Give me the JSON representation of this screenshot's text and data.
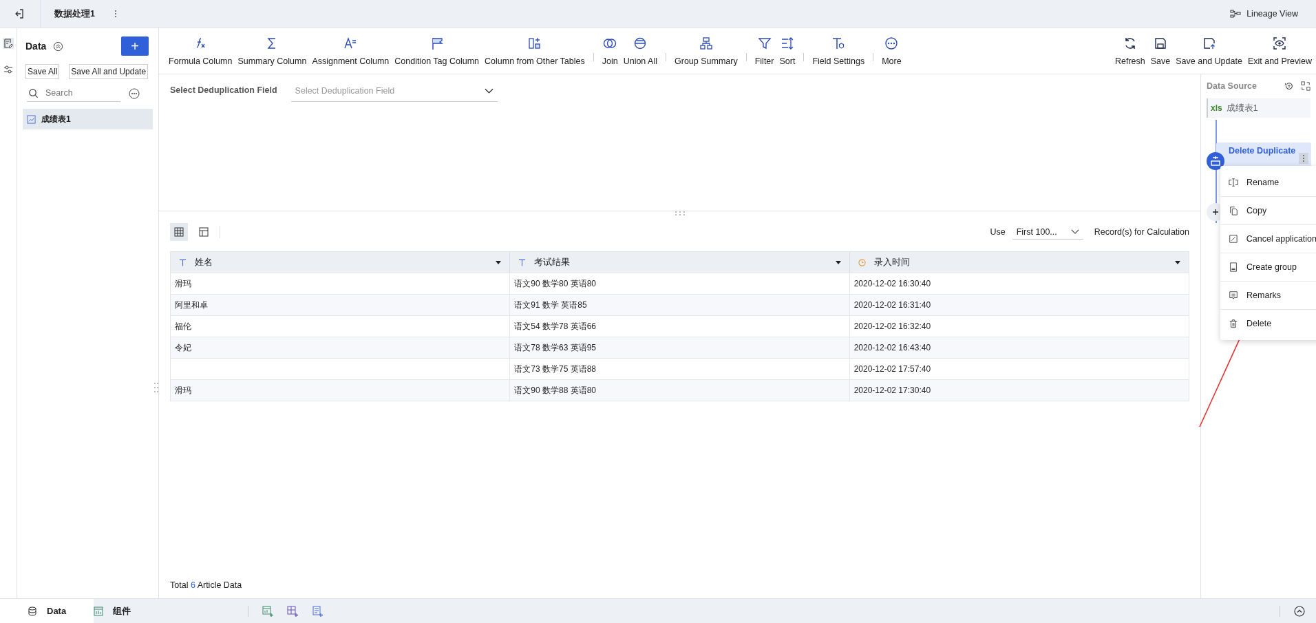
{
  "top_bar": {
    "title": "数据处理1",
    "lineage": "Lineage View"
  },
  "sidebar": {
    "title": "Data",
    "add": "+",
    "buttons": [
      "Save All",
      "Save All and Update"
    ],
    "search": {
      "placeholder": "Search"
    },
    "items": [
      {
        "label": "成绩表1",
        "selected": true
      }
    ]
  },
  "toolbar": {
    "groups": [
      [
        {
          "label": "Formula Column"
        },
        {
          "label": "Summary Column"
        },
        {
          "label": "Assignment Column"
        },
        {
          "label": "Condition Tag Column"
        },
        {
          "label": "Column from Other Tables"
        }
      ],
      [
        {
          "label": "Join"
        },
        {
          "label": "Union All"
        }
      ],
      [
        {
          "label": "Group Summary"
        }
      ],
      [
        {
          "label": "Filter"
        },
        {
          "label": "Sort"
        }
      ],
      [
        {
          "label": "Field Settings"
        }
      ],
      [
        {
          "label": "More"
        }
      ]
    ],
    "actions": [
      {
        "label": "Refresh"
      },
      {
        "label": "Save"
      },
      {
        "label": "Save and Update"
      },
      {
        "label": "Exit and Preview"
      }
    ]
  },
  "dedup": {
    "label": "Select Deduplication Field",
    "placeholder": "Select Deduplication Field"
  },
  "table_toolbar": {
    "views": [
      {
        "selected": true
      },
      {
        "selected": false
      }
    ],
    "use": "Use",
    "limit": "First 100...",
    "suffix": "Record(s) for Calculation"
  },
  "table": {
    "columns": [
      {
        "label": "姓名",
        "kind": "text"
      },
      {
        "label": "考试结果",
        "kind": "text"
      },
      {
        "label": "录入时间",
        "kind": "datetime"
      }
    ],
    "rows": [
      [
        "滑玛",
        "语文90 数学80 英语80",
        "2020-12-02 16:30:40"
      ],
      [
        "阿里和卓",
        "语文91 数学 英语85",
        "2020-12-02 16:31:40"
      ],
      [
        "福伦",
        "语文54 数学78 英语66",
        "2020-12-02 16:32:40"
      ],
      [
        "令妃",
        "语文78 数学63 英语95",
        "2020-12-02 16:43:40"
      ],
      [
        null,
        "语文73 数学75 英语88",
        "2020-12-02 17:57:40"
      ],
      [
        "滑玛",
        "语文90 数学88 英语80",
        "2020-12-02 17:30:40"
      ]
    ]
  },
  "total": {
    "prefix": "Total",
    "count": "6",
    "suffix": "Article Data"
  },
  "flow": {
    "title": "Data Source",
    "source": {
      "badge": "xls",
      "label": "成绩表1"
    },
    "step": {
      "label": "Delete Duplicate"
    }
  },
  "context_menu": [
    "Rename",
    "Copy",
    "Cancel application",
    "Create group",
    "Remarks",
    "Delete"
  ],
  "bottom_tabs": [
    {
      "label": "Data",
      "selected": true
    },
    {
      "label": "组件",
      "selected": false
    }
  ]
}
